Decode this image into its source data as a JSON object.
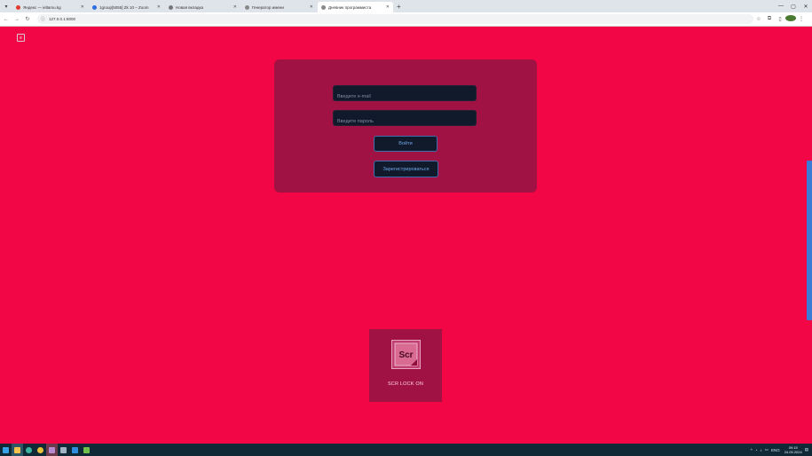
{
  "browser": {
    "tabs": [
      {
        "title": "Яндекс — ieltamu.kg",
        "favicon_color": "#e23b2e",
        "active": false
      },
      {
        "title": "1group[5055] Zk 10 – Zoom",
        "favicon_color": "#2d6de0",
        "active": false
      },
      {
        "title": "Новая вкладка",
        "favicon_color": "#777777",
        "active": false
      },
      {
        "title": "Генератор имени",
        "favicon_color": "#888888",
        "active": false
      },
      {
        "title": "Дневник программиста",
        "favicon_color": "#888888",
        "active": true
      }
    ],
    "url": "127.0.0.1:8000"
  },
  "login": {
    "email_placeholder": "Введите e-mail",
    "password_placeholder": "Введите пароль",
    "login_button": "Войти",
    "register_button": "Зарегистрироваться"
  },
  "brand": {
    "logo_text": "Scr",
    "caption": "SCR LOCK ON"
  },
  "taskbar": {
    "language": "ENG",
    "time": "09:15",
    "date": "24.05.2024"
  },
  "colors": {
    "page_background": "#f30645",
    "panel": "#9f1243",
    "input_bg": "#101a2b",
    "button_text": "#6ea4e6"
  }
}
